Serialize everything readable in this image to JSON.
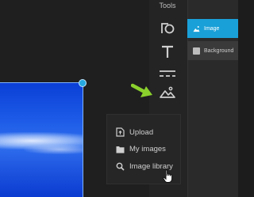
{
  "tools": {
    "title": "Tools",
    "items": [
      "shapes-icon",
      "text-icon",
      "lines-icon",
      "image-icon"
    ]
  },
  "layers": [
    {
      "label": "Image",
      "icon": "image-icon",
      "selected": true
    },
    {
      "label": "Background",
      "icon": "square-icon",
      "selected": false
    }
  ],
  "image_menu": {
    "items": [
      {
        "label": "Upload",
        "icon": "upload-icon"
      },
      {
        "label": "My images",
        "icon": "folder-icon"
      },
      {
        "label": "Image library",
        "icon": "search-icon"
      }
    ]
  },
  "colors": {
    "accent": "#1aa0d8",
    "annotation_arrow": "#8bd12d",
    "background": "#1c1c1c"
  }
}
